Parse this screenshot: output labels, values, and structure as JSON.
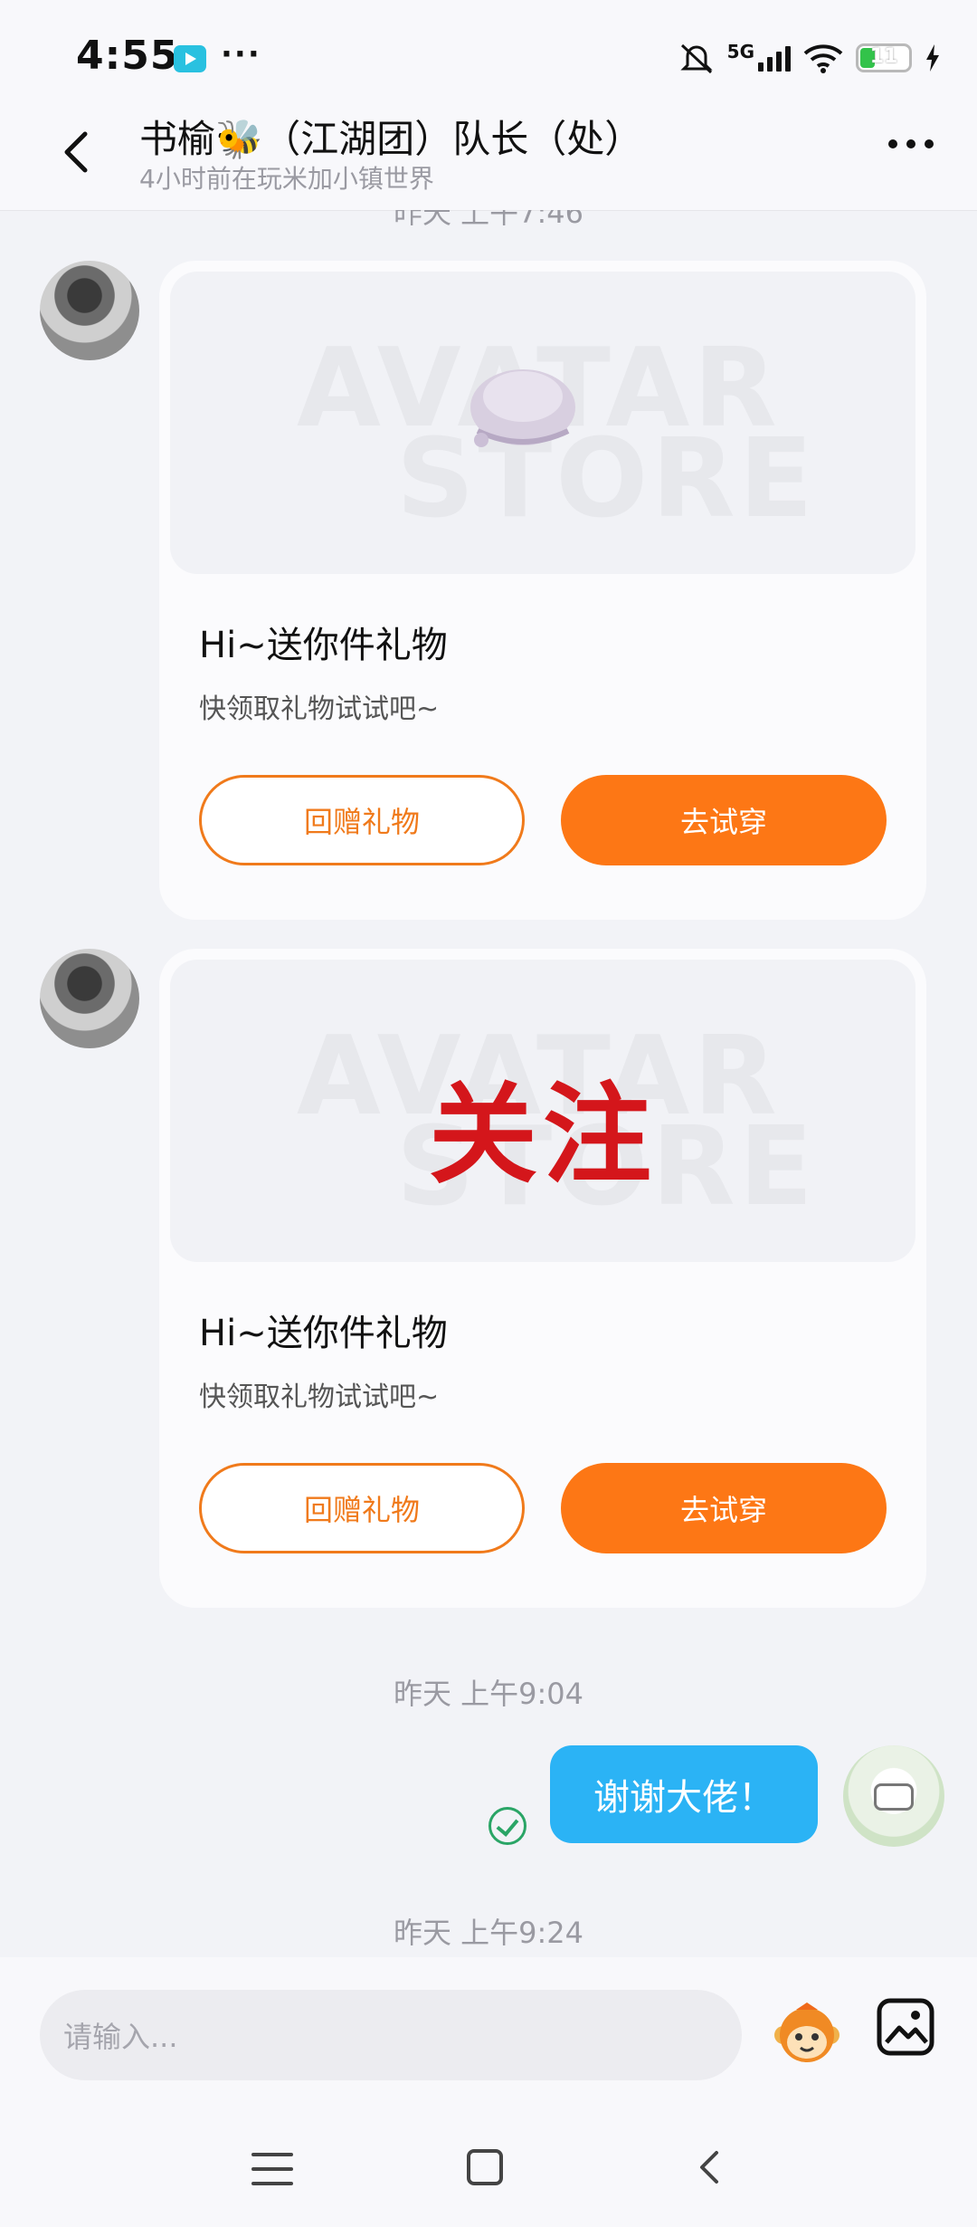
{
  "status_bar": {
    "time": "4:55",
    "more": "···",
    "network": "5G",
    "battery": "11",
    "icons": [
      "video-app-icon",
      "mute-icon",
      "signal-icon",
      "wifi-icon",
      "battery-icon",
      "charging-icon"
    ]
  },
  "header": {
    "title": "书榆🐝（江湖团）队长（处）",
    "subtitle": "4小时前在玩米加小镇世界"
  },
  "chat": {
    "timestamp_top_partial": "昨天 上午7:46",
    "cards": [
      {
        "watermark_line1": "AVATAR",
        "watermark_line2": "STORE",
        "gift_text": "",
        "title": "Hi~送你件礼物",
        "subtitle": "快领取礼物试试吧~",
        "return_gift": "回赠礼物",
        "try_on": "去试穿"
      },
      {
        "watermark_line1": "AVATAR",
        "watermark_line2": "STORE",
        "gift_text": "关注",
        "title": "Hi~送你件礼物",
        "subtitle": "快领取礼物试试吧~",
        "return_gift": "回赠礼物",
        "try_on": "去试穿"
      }
    ],
    "timestamp_1": "昨天 上午9:04",
    "my_message": "谢谢大佬！",
    "timestamp_2": "昨天 上午9:24"
  },
  "input": {
    "placeholder": "请输入..."
  },
  "colors": {
    "accent_orange": "#fd7715",
    "bubble_blue": "#2bb3f5",
    "sent_green": "#2aa566"
  }
}
